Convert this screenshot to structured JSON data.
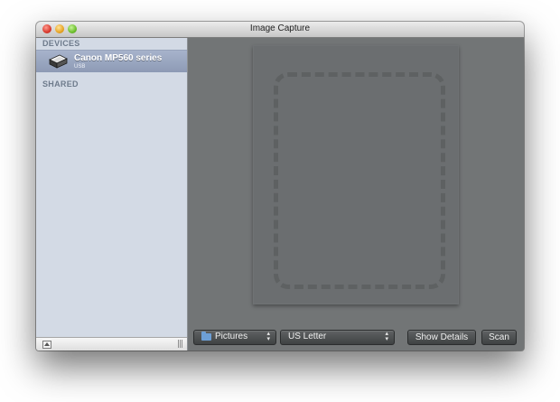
{
  "window": {
    "title": "Image Capture"
  },
  "sidebar": {
    "devices_header": "DEVICES",
    "shared_header": "SHARED",
    "devices": [
      {
        "name": "Canon MP560 series",
        "connection": "USB",
        "icon": "printer-icon",
        "selected": true
      }
    ]
  },
  "toolbar": {
    "destination": {
      "label": "Pictures",
      "icon": "folder-icon"
    },
    "page_size": {
      "label": "US Letter"
    },
    "show_details_label": "Show Details",
    "scan_label": "Scan"
  },
  "colors": {
    "sidebar_bg": "#d3dae5",
    "selection": "#97a3bb",
    "main_bg": "#727576",
    "folder": "#6d9fd6"
  }
}
